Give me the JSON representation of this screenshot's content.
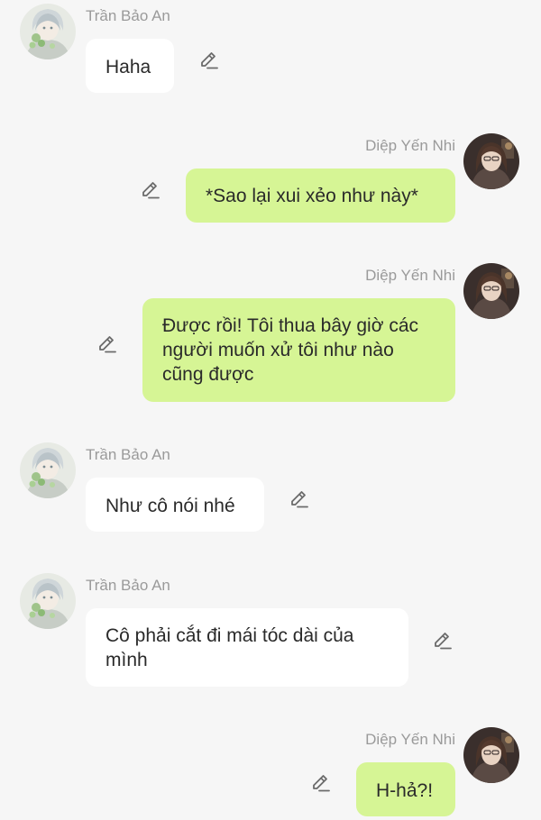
{
  "messages": [
    {
      "sender": "Trần Bảo An",
      "side": "left",
      "text": "Haha"
    },
    {
      "sender": "Diệp Yến Nhi",
      "side": "right",
      "text": "*Sao lại xui xẻo như này*"
    },
    {
      "sender": "Diệp Yến Nhi",
      "side": "right",
      "text": "Được rồi! Tôi thua bây giờ các người muốn xử tôi như nào cũng được"
    },
    {
      "sender": "Trần Bảo An",
      "side": "left",
      "text": "Như cô nói nhé"
    },
    {
      "sender": "Trần Bảo An",
      "side": "left",
      "text": "Cô phải cắt đi mái tóc dài của mình"
    },
    {
      "sender": "Diệp Yến Nhi",
      "side": "right",
      "text": "H-hả?!"
    }
  ],
  "icons": {
    "edit": "pencil-edit-icon",
    "avatar_left": "avatar-tran-bao-an",
    "avatar_right": "avatar-diep-yen-nhi"
  },
  "colors": {
    "background": "#f6f6f6",
    "bubble_left": "#ffffff",
    "bubble_right": "#d6f595",
    "name_text": "#9a9a9a",
    "message_text": "#2a2a2a"
  }
}
